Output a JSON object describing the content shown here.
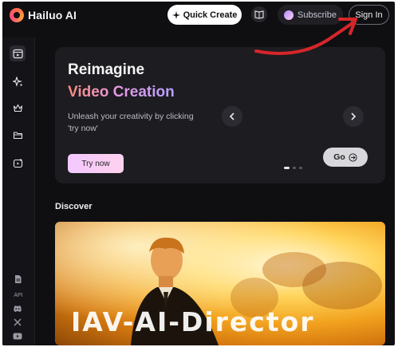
{
  "app": {
    "name": "Hailuo AI"
  },
  "header": {
    "quick_create_label": "Quick Create",
    "subscribe_label": "Subscribe",
    "sign_in_label": "Sign In"
  },
  "sidebar": {
    "items": [
      {
        "icon": "video-icon"
      },
      {
        "icon": "sparkle-icon"
      },
      {
        "icon": "crown-icon"
      },
      {
        "icon": "folder-icon"
      },
      {
        "icon": "upload-icon"
      }
    ],
    "footer": {
      "api_label": "API",
      "icons": [
        "document-icon",
        "discord-icon",
        "x-icon",
        "youtube-icon"
      ]
    }
  },
  "hero": {
    "title_line1": "Reimagine",
    "title_line2": "Video Creation",
    "description": "Unleash your creativity by clicking 'try now'",
    "try_now_label": "Try now",
    "go_label": "Go",
    "slides_total": 3,
    "slide_active": 1
  },
  "discover": {
    "heading": "Discover",
    "thumb_text": "IAV-AI-Director"
  },
  "colors": {
    "background": "#0f0f12",
    "accent_arrow": "#d6262a",
    "try_now_gradient": "#f2c8ff"
  }
}
